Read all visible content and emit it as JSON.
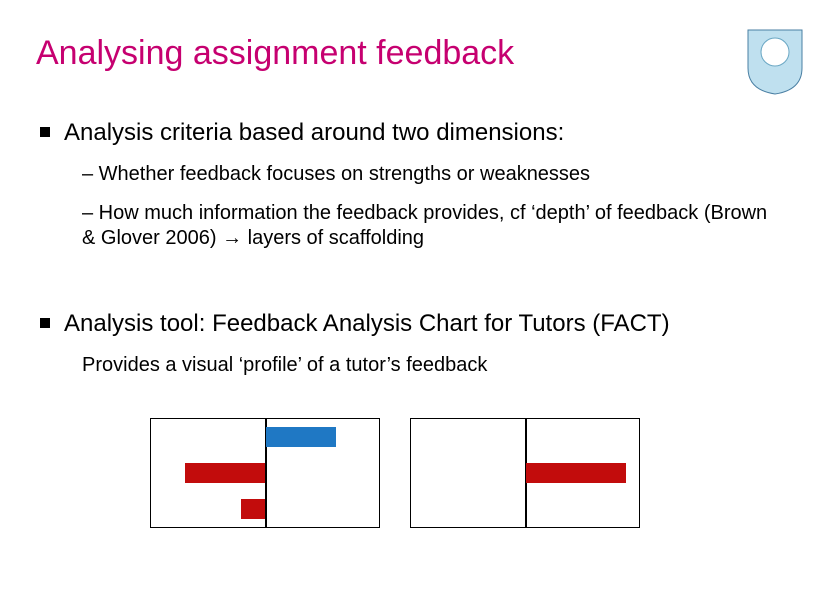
{
  "title": "Analysing assignment feedback",
  "bullets": [
    {
      "text": "Analysis criteria based around two dimensions:",
      "children": [
        {
          "text": "– Whether feedback focuses on strengths or weaknesses"
        },
        {
          "text": "– How much information the feedback provides, cf ‘depth’ of feedback (Brown & Glover 2006) → layers of scaffolding"
        }
      ]
    },
    {
      "text": "Analysis tool: Feedback Analysis Chart for Tutors (FACT)",
      "description": "Provides a visual ‘profile’ of a tutor’s feedback"
    }
  ],
  "colors": {
    "title": "#c60070",
    "bar_blue": "#1f78c4",
    "bar_red": "#c20c0c"
  },
  "chart_data": [
    {
      "type": "bar",
      "title": "",
      "xlabel": "",
      "ylabel": "",
      "series": [
        {
          "name": "blue",
          "side": "right",
          "row": 0,
          "length": 70
        },
        {
          "name": "red",
          "side": "left",
          "row": 1,
          "length": 80
        },
        {
          "name": "red",
          "side": "left",
          "row": 2,
          "length": 24
        }
      ],
      "axis_range": [
        -115,
        115
      ]
    },
    {
      "type": "bar",
      "title": "",
      "xlabel": "",
      "ylabel": "",
      "series": [
        {
          "name": "red",
          "side": "right",
          "row": 1,
          "length": 100
        }
      ],
      "axis_range": [
        -115,
        115
      ]
    }
  ]
}
